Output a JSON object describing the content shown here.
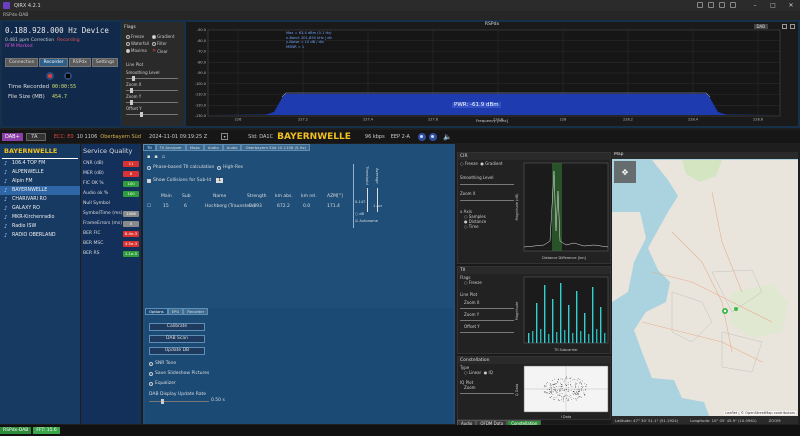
{
  "window": {
    "title": "QIRX 4.2.1",
    "subtitle": "RSPdx-DAB"
  },
  "receiver": {
    "frequency": "0.188.928.000 Hz Device",
    "ppm": "0.481 ppm Correction",
    "recording_flag": "Recording",
    "attenuation": "RFM Marked",
    "tabs": [
      "Connection",
      "Recorder",
      "RSPdx",
      "Settings"
    ],
    "active_tab": "Recorder",
    "time_recorded_label": "Time Recorded",
    "time_recorded_value": "00:00:55",
    "file_size_label": "File Size (MB)",
    "file_size_value": "454.7"
  },
  "flags_panel": {
    "title": "Flags",
    "items": [
      {
        "label": "Freeze",
        "on": false
      },
      {
        "label": "Gradient",
        "on": true
      },
      {
        "label": "Waterfall",
        "on": false
      },
      {
        "label": "Filter",
        "on": false
      },
      {
        "label": "Maxima",
        "on": true
      },
      {
        "label": "Clear",
        "on": false
      }
    ],
    "line_plot": "Line Plot",
    "smoothing": "Smoothing Level",
    "zoom_x": "Zoom X",
    "zoom_y": "Zoom Y",
    "offset_y": "Offset Y"
  },
  "spectrum": {
    "title": "RSPdx",
    "mode": "DAB",
    "info": [
      "Max = 63.4 dBm (0.1 Hz)",
      "n-Band: 201,850 kHz | dir",
      "y-Noise = 10 dB / div",
      "MSNR = 1"
    ],
    "pwr": "PWR: -61.9 dBm",
    "xlabel": "Frequency [MHz]",
    "yticks": [
      "-50.0",
      "-60.0",
      "-70.0",
      "-80.0",
      "-90.0",
      "-100.0",
      "-110.0",
      "-120.0",
      "-130.0"
    ],
    "xticks": [
      "226",
      "227.2",
      "227.4",
      "227.6",
      "227.8",
      "228",
      "228.2",
      "228.4",
      "228.6"
    ]
  },
  "station": {
    "standard": "DAB+",
    "channel": "7A",
    "ecc": "ECC: E0",
    "ensemble": "Oberbayern Süd",
    "ensemble_id": "10 1106",
    "datetime": "2024-11-01   09:19:25 Z",
    "sid": "SId: DA1C",
    "name": "BAYERNWELLE",
    "bitrate": "96 kbps",
    "eep": "EEP 2-A"
  },
  "services": {
    "title": "BAYERNWELLE",
    "items": [
      "106.4 TOP FM",
      "ALPENWELLE",
      "Alpin FM",
      "BAYERNWELLE",
      "CHARIVARI RO",
      "GALAXY RO",
      "MKR-Kirchenradio",
      "Radio ISW",
      "RADIO OBERLAND"
    ],
    "selected": 3
  },
  "quality": {
    "title": "Service Quality",
    "rows": [
      {
        "label": "CNR (dB)",
        "value": "11",
        "color": "red"
      },
      {
        "label": "MER (dB)",
        "value": "8",
        "color": "red"
      },
      {
        "label": "FIC OK %",
        "value": "100",
        "color": "green"
      },
      {
        "label": "Audio ok %",
        "value": "100",
        "color": "green"
      },
      {
        "label": "Null Symbol",
        "value": "",
        "color": "none"
      },
      {
        "label": "SymbolTime (ms)",
        "value": "1006",
        "color": "grey"
      },
      {
        "label": "FrameErrors (ms)",
        "value": "0",
        "color": "grey"
      },
      {
        "label": "BER FIC",
        "value": "8.4e-3",
        "color": "red"
      },
      {
        "label": "BER MSC",
        "value": "4.5e-3",
        "color": "red"
      },
      {
        "label": "BER RS",
        "value": "1.1e-5",
        "color": "green"
      }
    ]
  },
  "tii": {
    "tabs": [
      "TII",
      "TII Analyzer",
      "Maps",
      "Audio",
      "Audio",
      "Oberbayern Süd 10.1106 (S.Hz)"
    ],
    "phase_calc": "Phase-based TII calculation",
    "high_res": "High-Res",
    "collisions": "Show Collisions for Sub-Id",
    "collision_value": "1",
    "headers": [
      "Main",
      "Sub",
      "Name",
      "Strength",
      "km abs.",
      "km rel.",
      "AZM[°]"
    ],
    "row": [
      "15",
      "6",
      "Hochberg (Traunstein)",
      "0.893",
      "672.2",
      "0.0",
      "171.4"
    ],
    "side_labels": [
      "Threshold",
      "Average",
      "Scroll",
      "0.147",
      "dB",
      "1 Avr",
      "Autoname"
    ]
  },
  "options": {
    "tabs": [
      "Options",
      "EPG",
      "Recorder"
    ],
    "calibrate": "Calibrate",
    "dab_scan": "DAB Scan",
    "update_db": "Update DB",
    "snr_tone": "SNR Tone",
    "save_slideshow": "Save Slideshow Pictures",
    "equalizer": "Equalizer",
    "rate_label": "DAB Display Update Rate",
    "rate_value": "0.50 s"
  },
  "cir": {
    "title": "CIR",
    "opts": [
      "Freeze",
      "Gradient"
    ],
    "smoothing": "Smoothing Level",
    "zoom_x": "Zoom X",
    "xaxis": "x Axis",
    "axis_opts": [
      "Samples",
      "Distance",
      "Time"
    ],
    "ylabel": "Magnitude (dB)",
    "xlabel": "Distance Difference [km]"
  },
  "tii_plot": {
    "title": "TII",
    "flags": "Flags",
    "freeze": "Freeze",
    "line_plot": "Line Plot",
    "zoom_x": "Zoom X",
    "zoom_y": "Zoom Y",
    "offset_y": "Offset Y",
    "ylabel": "Magnitude",
    "xlabel": "TII Subcarrier"
  },
  "constellation": {
    "title": "Constellation",
    "type": "Type",
    "opts": [
      "Linear",
      "IQ"
    ],
    "iq_plot": "IQ Plot",
    "zoom": "Zoom",
    "xlabel": "I Data",
    "ylabel": "Q Data"
  },
  "bottom_tabs": [
    "Audio",
    "OFDM Data",
    "Constellation"
  ],
  "map": {
    "title": "Map",
    "attribution": "Leaflet | © OpenStreetMap contributors",
    "lat": "Latitude: 47° 30' 51.1\" (51.1924)",
    "lon": "Longitude: 10° 05' 45.9\" (10.0961)",
    "zoom": "ZOOM",
    "cursor": "Cursor: 10°"
  },
  "statusbar": [
    "RSPdx-DAB",
    "FFT: 15.6"
  ]
}
